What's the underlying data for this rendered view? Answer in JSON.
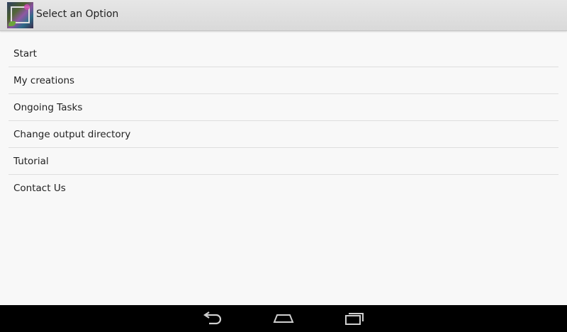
{
  "action_bar": {
    "title": "Select an Option",
    "app_icon": "photo-frame-app-icon"
  },
  "menu": {
    "items": [
      {
        "label": "Start"
      },
      {
        "label": "My creations"
      },
      {
        "label": "Ongoing Tasks"
      },
      {
        "label": "Change output directory"
      },
      {
        "label": "Tutorial"
      },
      {
        "label": "Contact Us"
      }
    ]
  },
  "nav_bar": {
    "back_icon": "back-icon",
    "home_icon": "home-icon",
    "recent_icon": "recent-apps-icon"
  },
  "colors": {
    "background": "#f8f8f8",
    "action_bar": "#dcdcdc",
    "divider": "#dedede",
    "nav_bar": "#000000",
    "nav_icon": "#cfcfcf"
  }
}
